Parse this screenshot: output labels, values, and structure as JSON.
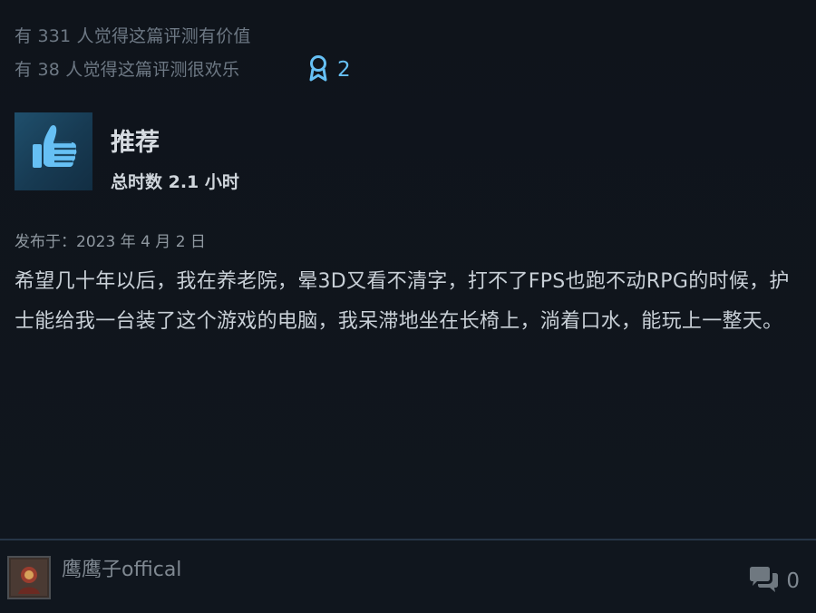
{
  "votes": {
    "helpful_text": "有 331 人觉得这篇评测有价值",
    "funny_text": "有 38 人觉得这篇评测很欢乐"
  },
  "award": {
    "icon": "award-ribbon-icon",
    "count": "2",
    "color": "#66c0f4"
  },
  "verdict": {
    "icon": "thumbs-up-icon",
    "label": "推荐",
    "hours": "总时数 2.1 小时"
  },
  "review": {
    "posted": "发布于：2023 年 4 月 2 日",
    "body": "希望几十年以后，我在养老院，晕3D又看不清字，打不了FPS也跑不动RPG的时候，护士能给我一台装了这个游戏的电脑，我呆滞地坐在长椅上，淌着口水，能玩上一整天。"
  },
  "footer": {
    "author": "鹰鹰子offical",
    "avatar_icon": "user-avatar",
    "comments_icon": "speech-bubbles-icon",
    "comments_count": "0"
  }
}
